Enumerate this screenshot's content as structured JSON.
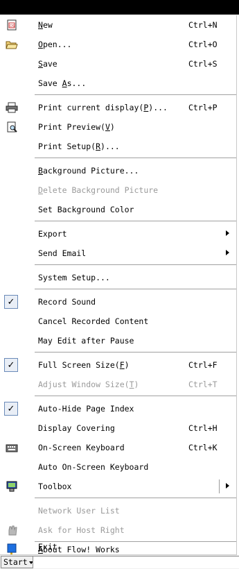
{
  "menu": {
    "items": [
      {
        "label_pre": "",
        "label_u": "N",
        "label_post": "ew",
        "shortcut": "Ctrl+N",
        "icon": "new-document-icon"
      },
      {
        "label_pre": "",
        "label_u": "O",
        "label_post": "pen...",
        "shortcut": "Ctrl+O",
        "icon": "open-folder-icon"
      },
      {
        "label_pre": "",
        "label_u": "S",
        "label_post": "ave",
        "shortcut": "Ctrl+S"
      },
      {
        "label_pre": "Save ",
        "label_u": "A",
        "label_post": "s..."
      },
      {
        "label_pre": "Print current display(",
        "label_u": "P",
        "label_post": ")...",
        "shortcut": "Ctrl+P",
        "icon": "printer-icon"
      },
      {
        "label_pre": "Print Preview(",
        "label_u": "V",
        "label_post": ")",
        "icon": "print-preview-icon"
      },
      {
        "label_pre": "Print Setup(",
        "label_u": "R",
        "label_post": ")..."
      },
      {
        "label_pre": "",
        "label_u": "B",
        "label_post": "ackground Picture..."
      },
      {
        "label_pre": "",
        "label_u": "D",
        "label_post": "elete Background Picture",
        "disabled": true
      },
      {
        "label_pre": "Set Background Color"
      },
      {
        "label_pre": "Export",
        "submenu": true
      },
      {
        "label_pre": "Send Email",
        "submenu": true
      },
      {
        "label_pre": "System Setup..."
      },
      {
        "label_pre": "Record Sound",
        "checked": true
      },
      {
        "label_pre": "Cancel Recorded Content"
      },
      {
        "label_pre": "May Edit after Pause"
      },
      {
        "label_pre": "Full Screen Size(",
        "label_u": "F",
        "label_post": ")",
        "shortcut": "Ctrl+F",
        "checked": true
      },
      {
        "label_pre": "Adjust Window Size(",
        "label_u": "T",
        "label_post": ")",
        "shortcut": "Ctrl+T",
        "disabled": true
      },
      {
        "label_pre": "Auto-Hide Page Index",
        "checked": true
      },
      {
        "label_pre": "Display Covering",
        "shortcut": "Ctrl+H"
      },
      {
        "label_pre": "On-Screen Keyboard",
        "shortcut": "Ctrl+K",
        "icon": "keyboard-icon"
      },
      {
        "label_pre": "Auto On-Screen Keyboard"
      },
      {
        "label_pre": "Toolbox",
        "submenu": true,
        "icon": "toolbox-icon"
      },
      {
        "label_pre": "Network User List",
        "disabled": true
      },
      {
        "label_pre": "Ask for Host Right",
        "disabled": true,
        "icon": "hand-icon"
      },
      {
        "label_pre": "",
        "label_u": "A",
        "label_post": "bout Flow! Works",
        "icon": "help-icon"
      },
      {
        "label_pre": "",
        "label_u": "E",
        "label_post": "xit",
        "icon": "exit-icon"
      }
    ]
  },
  "startbar": {
    "label": "Start"
  }
}
